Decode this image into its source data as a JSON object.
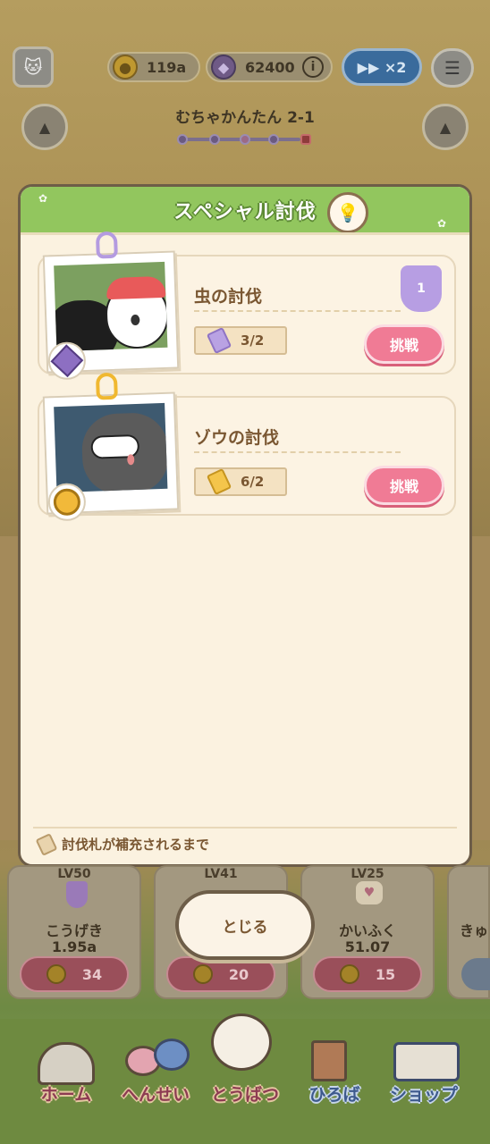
{
  "hud": {
    "coins": "119a",
    "gems": "62400",
    "speed_label": "▶▶ ×2",
    "stage_title": "むちゃかんたん 2-1"
  },
  "modal": {
    "title": "スペシャル討伐",
    "missions": [
      {
        "name": "虫の討伐",
        "tickets": "3/2",
        "button": "挑戦",
        "rank": "1"
      },
      {
        "name": "ゾウの討伐",
        "tickets": "6/2",
        "button": "挑戦"
      }
    ],
    "footer": "討伐札が補充されるまで"
  },
  "close_label": "とじる",
  "upgrades": [
    {
      "level": "LV50",
      "name": "こうげき",
      "value": "1.95a",
      "cost": "34"
    },
    {
      "level": "LV41",
      "name": "",
      "value": "",
      "cost": "20"
    },
    {
      "level": "LV25",
      "name": "かいふく",
      "value": "51.07",
      "cost": "15"
    },
    {
      "level": "",
      "name": "きゅ",
      "value": "",
      "cost": ""
    }
  ],
  "nav": {
    "home": "ホーム",
    "formation": "へんせい",
    "battle": "とうばつ",
    "plaza": "ひろば",
    "shop": "ショップ"
  },
  "colors": {
    "header_green": "#92c65e",
    "challenge_pink": "#f07b95",
    "modal_bg": "#fbf2e0",
    "text_brown": "#7a5732"
  }
}
